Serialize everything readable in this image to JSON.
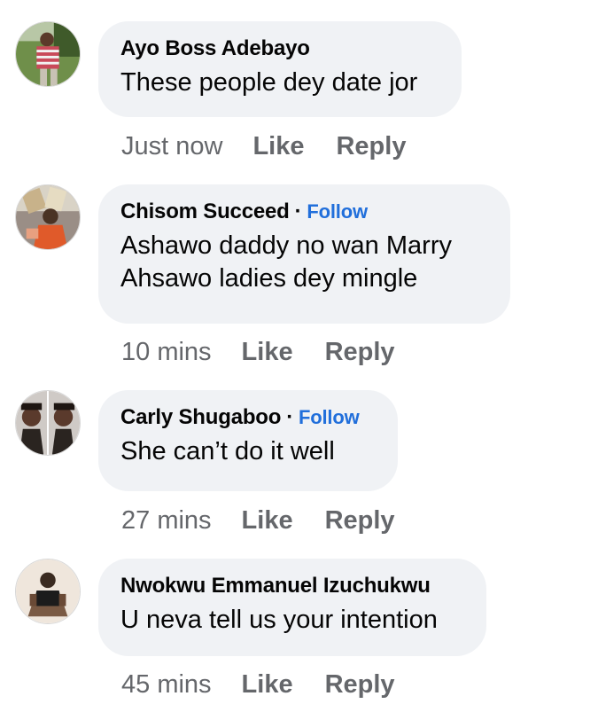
{
  "comments": [
    {
      "author": "Ayo Boss Adebayo",
      "follow": "",
      "text": [
        "These people dey date jor"
      ],
      "time": "Just now",
      "like": "Like",
      "reply": "Reply"
    },
    {
      "author": "Chisom Succeed",
      "follow": "Follow",
      "text": [
        "Ashawo daddy no wan Marry",
        "Ahsawo ladies dey mingle"
      ],
      "time": "10 mins",
      "like": "Like",
      "reply": "Reply"
    },
    {
      "author": "Carly Shugaboo",
      "follow": "Follow",
      "text": [
        "She can’t do it well"
      ],
      "time": "27 mins",
      "like": "Like",
      "reply": "Reply"
    },
    {
      "author": "Nwokwu Emmanuel Izuchukwu",
      "follow": "",
      "text": [
        "U neva tell us your intention"
      ],
      "time": "45 mins",
      "like": "Like",
      "reply": "Reply"
    }
  ],
  "separator": "·"
}
